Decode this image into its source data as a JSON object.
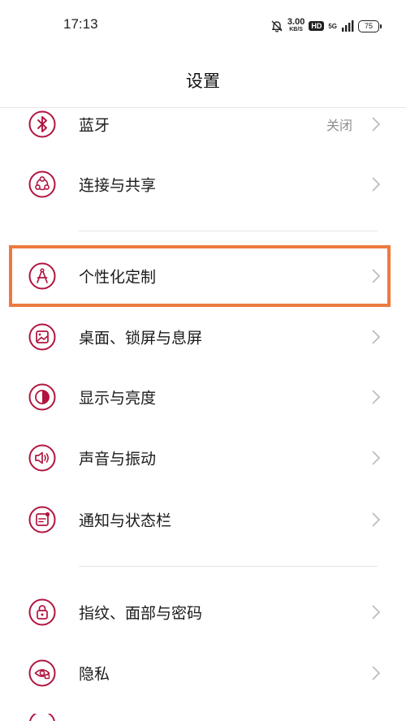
{
  "status_bar": {
    "time": "17:13",
    "speed_value": "3.00",
    "speed_unit": "KB/S",
    "hd_label": "HD",
    "network_label": "5G",
    "battery_level": "75"
  },
  "page_title": "设置",
  "accent_color": "#b1153f",
  "highlight_color": "#ec7a3f",
  "items": [
    {
      "label": "蓝牙",
      "value": "关闭",
      "icon": "bluetooth-icon"
    },
    {
      "label": "连接与共享",
      "icon": "share-icon"
    },
    {
      "label": "个性化定制",
      "icon": "personalization-icon"
    },
    {
      "label": "桌面、锁屏与息屏",
      "icon": "wallpaper-icon"
    },
    {
      "label": "显示与亮度",
      "icon": "display-icon"
    },
    {
      "label": "声音与振动",
      "icon": "sound-icon"
    },
    {
      "label": "通知与状态栏",
      "icon": "notification-icon"
    },
    {
      "label": "指纹、面部与密码",
      "icon": "lock-icon"
    },
    {
      "label": "隐私",
      "icon": "privacy-icon"
    }
  ]
}
